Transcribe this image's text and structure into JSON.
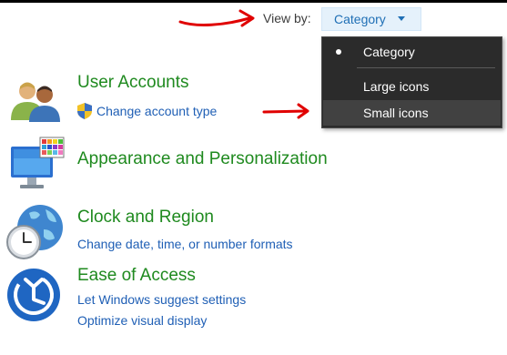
{
  "view_by": {
    "label": "View by:",
    "selected": "Category",
    "options": [
      "Category",
      "Large icons",
      "Small icons"
    ],
    "checked_option": "Category",
    "hovered_option": "Small icons"
  },
  "categories": [
    {
      "title": "User Accounts",
      "icon": "user-accounts-icon",
      "links": [
        "Change account type"
      ],
      "link_icons": [
        "uac-shield-icon"
      ]
    },
    {
      "title": "Appearance and Personalization",
      "icon": "appearance-icon",
      "links": []
    },
    {
      "title": "Clock and Region",
      "icon": "clock-region-icon",
      "links": [
        "Change date, time, or number formats"
      ]
    },
    {
      "title": "Ease of Access",
      "icon": "ease-of-access-icon",
      "links": [
        "Let Windows suggest settings",
        "Optimize visual display"
      ]
    }
  ],
  "colors": {
    "category_title": "#1f8a1f",
    "link": "#1f5fb5",
    "menu_bg": "#2b2b2b",
    "annotation_arrow": "#e00000"
  }
}
